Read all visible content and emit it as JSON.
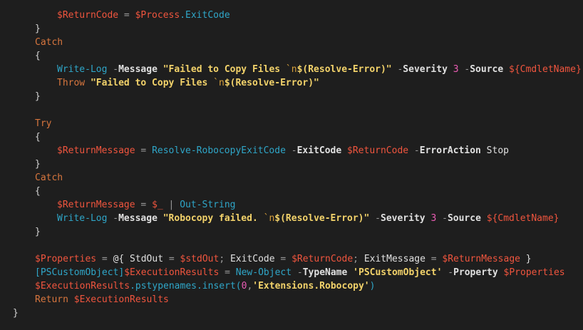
{
  "editor": {
    "background": "#1e1e1e",
    "colors": {
      "keyword": "#d8763e",
      "variable": "#f0553e",
      "cmdlet": "#2fa6c8",
      "parameter": "#e0e0e0",
      "operator": "#9b9b9b",
      "string": "#f2d26a",
      "number": "#ea5cb4",
      "plain": "#d4d4d4"
    },
    "lines": [
      [
        {
          "t": "$ReturnCode",
          "c": "var"
        },
        {
          "t": " = ",
          "c": "op"
        },
        {
          "t": "$Process",
          "c": "var"
        },
        {
          "t": ".ExitCode",
          "c": "cmd"
        }
      ],
      [
        {
          "t": "}",
          "c": "br"
        }
      ],
      [
        {
          "t": "Catch",
          "c": "kw"
        }
      ],
      [
        {
          "t": "{",
          "c": "br"
        }
      ],
      [
        {
          "t": "Write-Log",
          "c": "cmd"
        },
        {
          "t": " -",
          "c": "op"
        },
        {
          "t": "Message",
          "c": "par"
        },
        {
          "t": " ",
          "c": "pl"
        },
        {
          "t": "\"Failed to Copy Files ",
          "c": "str"
        },
        {
          "t": "`n",
          "c": "esc"
        },
        {
          "t": "$(Resolve-Error)\"",
          "c": "str"
        },
        {
          "t": " -",
          "c": "op"
        },
        {
          "t": "Severity",
          "c": "par"
        },
        {
          "t": " 3",
          "c": "num"
        },
        {
          "t": " -",
          "c": "op"
        },
        {
          "t": "Source",
          "c": "par"
        },
        {
          "t": " ${CmdletName}",
          "c": "var"
        }
      ],
      [
        {
          "t": "Throw",
          "c": "kw"
        },
        {
          "t": " ",
          "c": "pl"
        },
        {
          "t": "\"Failed to Copy Files ",
          "c": "str"
        },
        {
          "t": "`n",
          "c": "esc"
        },
        {
          "t": "$(Resolve-Error)\"",
          "c": "str"
        }
      ],
      [
        {
          "t": "}",
          "c": "br"
        }
      ],
      [],
      [
        {
          "t": "Try",
          "c": "kw"
        }
      ],
      [
        {
          "t": "{",
          "c": "br"
        }
      ],
      [
        {
          "t": "$ReturnMessage",
          "c": "var"
        },
        {
          "t": " = ",
          "c": "op"
        },
        {
          "t": "Resolve-RobocopyExitCode",
          "c": "cmd"
        },
        {
          "t": " -",
          "c": "op"
        },
        {
          "t": "ExitCode",
          "c": "par"
        },
        {
          "t": " $ReturnCode",
          "c": "var"
        },
        {
          "t": " -",
          "c": "op"
        },
        {
          "t": "ErrorAction",
          "c": "par"
        },
        {
          "t": " Stop",
          "c": "pl"
        }
      ],
      [
        {
          "t": "}",
          "c": "br"
        }
      ],
      [
        {
          "t": "Catch",
          "c": "kw"
        }
      ],
      [
        {
          "t": "{",
          "c": "br"
        }
      ],
      [
        {
          "t": "$ReturnMessage",
          "c": "var"
        },
        {
          "t": " = ",
          "c": "op"
        },
        {
          "t": "$_",
          "c": "var"
        },
        {
          "t": " | ",
          "c": "op"
        },
        {
          "t": "Out-String",
          "c": "cmd"
        }
      ],
      [
        {
          "t": "Write-Log",
          "c": "cmd"
        },
        {
          "t": " -",
          "c": "op"
        },
        {
          "t": "Message",
          "c": "par"
        },
        {
          "t": " ",
          "c": "pl"
        },
        {
          "t": "\"Robocopy failed. ",
          "c": "str"
        },
        {
          "t": "`n",
          "c": "esc"
        },
        {
          "t": "$(Resolve-Error)\"",
          "c": "str"
        },
        {
          "t": " -",
          "c": "op"
        },
        {
          "t": "Severity",
          "c": "par"
        },
        {
          "t": " 3",
          "c": "num"
        },
        {
          "t": " -",
          "c": "op"
        },
        {
          "t": "Source",
          "c": "par"
        },
        {
          "t": " ${CmdletName}",
          "c": "var"
        }
      ],
      [
        {
          "t": "}",
          "c": "br"
        }
      ],
      [],
      [
        {
          "t": "$Properties",
          "c": "var"
        },
        {
          "t": " = ",
          "c": "op"
        },
        {
          "t": "@{",
          "c": "pl"
        },
        {
          "t": " StdOut",
          "c": "pl"
        },
        {
          "t": " = ",
          "c": "op"
        },
        {
          "t": "$stdOut",
          "c": "var"
        },
        {
          "t": ";",
          "c": "op"
        },
        {
          "t": " ExitCode",
          "c": "pl"
        },
        {
          "t": " = ",
          "c": "op"
        },
        {
          "t": "$ReturnCode",
          "c": "var"
        },
        {
          "t": ";",
          "c": "op"
        },
        {
          "t": " ExitMessage",
          "c": "pl"
        },
        {
          "t": " = ",
          "c": "op"
        },
        {
          "t": "$ReturnMessage",
          "c": "var"
        },
        {
          "t": " }",
          "c": "pl"
        }
      ],
      [
        {
          "t": "[PSCustomObject]",
          "c": "type"
        },
        {
          "t": "$ExecutionResults",
          "c": "var"
        },
        {
          "t": " = ",
          "c": "op"
        },
        {
          "t": "New-Object",
          "c": "cmd"
        },
        {
          "t": " -",
          "c": "op"
        },
        {
          "t": "TypeName",
          "c": "par"
        },
        {
          "t": " ",
          "c": "pl"
        },
        {
          "t": "'PSCustomObject'",
          "c": "str"
        },
        {
          "t": " -",
          "c": "op"
        },
        {
          "t": "Property",
          "c": "par"
        },
        {
          "t": " $Properties",
          "c": "var"
        }
      ],
      [
        {
          "t": "$ExecutionResults",
          "c": "var"
        },
        {
          "t": ".pstypenames.insert(",
          "c": "cmd"
        },
        {
          "t": "0",
          "c": "num"
        },
        {
          "t": ",",
          "c": "op"
        },
        {
          "t": "'Extensions.Robocopy'",
          "c": "str"
        },
        {
          "t": ")",
          "c": "cmd"
        }
      ],
      [
        {
          "t": "Return",
          "c": "kw"
        },
        {
          "t": " $ExecutionResults",
          "c": "var"
        }
      ],
      [
        {
          "t": "}",
          "c": "br"
        }
      ]
    ]
  }
}
